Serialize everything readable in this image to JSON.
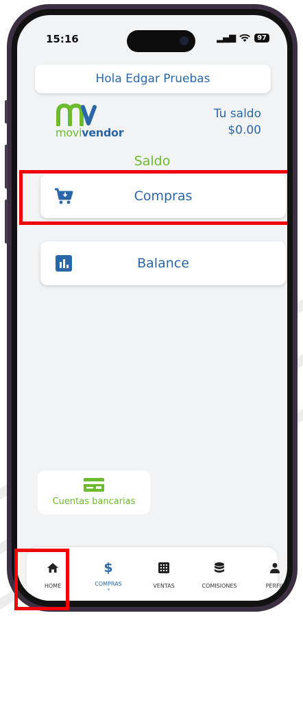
{
  "status": {
    "time": "15:16",
    "battery": "97"
  },
  "header": {
    "greeting": "Hola Edgar Pruebas"
  },
  "brand": {
    "logo_part1": "movi",
    "logo_part2": "vendor",
    "green": "#6cbb2f",
    "blue": "#2a67a8"
  },
  "balance": {
    "label": "Tu saldo",
    "value": "$0.00"
  },
  "section": {
    "title": "Saldo"
  },
  "cards": [
    {
      "label": "Compras",
      "icon": "cart-download-icon"
    },
    {
      "label": "Balance",
      "icon": "bar-chart-icon"
    }
  ],
  "bank": {
    "label": "Cuentas bancarias",
    "icon": "credit-card-icon"
  },
  "tabs": [
    {
      "label": "HOME",
      "icon": "home-icon"
    },
    {
      "label": "COMPRAS",
      "icon": "dollar-icon",
      "active": true
    },
    {
      "label": "VENTAS",
      "icon": "calculator-icon"
    },
    {
      "label": "COMISIONES",
      "icon": "coins-stack-icon"
    },
    {
      "label": "PERFIL",
      "icon": "person-icon"
    }
  ],
  "highlight_color": "#f00202"
}
